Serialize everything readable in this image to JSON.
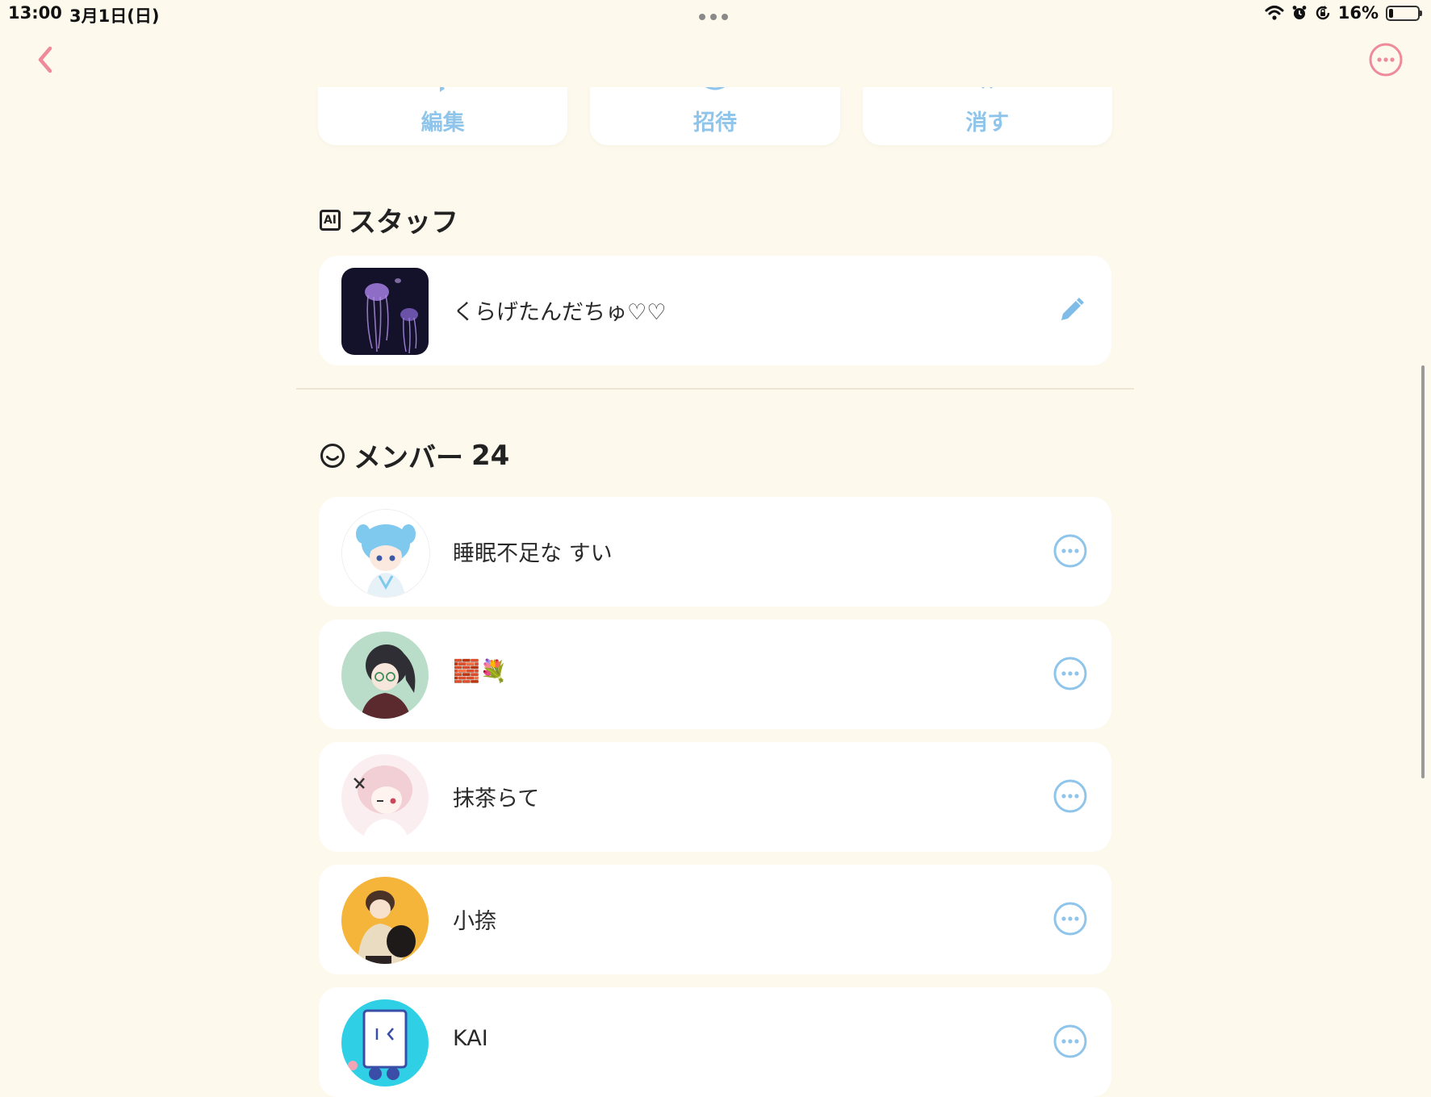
{
  "status_bar": {
    "time": "13:00",
    "date": "3月1日(日)",
    "battery": "16%",
    "battery_level": 0.16
  },
  "nav": {
    "back_icon": "chevron-left-icon",
    "more_icon": "more-circle-icon"
  },
  "actions": [
    {
      "label": "編集",
      "icon": "pencil-icon"
    },
    {
      "label": "招待",
      "icon": "invite-icon"
    },
    {
      "label": "消す",
      "icon": "trash-icon"
    }
  ],
  "staff": {
    "title": "スタッフ",
    "badge": "AI",
    "items": [
      {
        "name": "くらげたんだちゅ♡♡",
        "avatar": "jellyfish-avatar",
        "action_icon": "pencil-icon"
      }
    ]
  },
  "members": {
    "title": "メンバー",
    "count": "24",
    "items": [
      {
        "name": "睡眠不足な すい",
        "avatar": "blue-hair-girl-avatar",
        "action_icon": "more-circle-icon"
      },
      {
        "name": "🧱💐",
        "avatar": "dark-hair-glasses-avatar",
        "action_icon": "more-circle-icon"
      },
      {
        "name": "抹茶らて",
        "avatar": "pink-hair-girl-avatar",
        "action_icon": "more-circle-icon"
      },
      {
        "name": "小捺",
        "avatar": "orange-bg-boy-avatar",
        "action_icon": "more-circle-icon"
      },
      {
        "name": "KAI",
        "avatar": "cyan-character-avatar",
        "action_icon": "more-circle-icon"
      }
    ]
  },
  "colors": {
    "background": "#fdf9ec",
    "accent_pink": "#ee8a9a",
    "accent_blue": "#8fc5ea",
    "card": "#ffffff"
  }
}
